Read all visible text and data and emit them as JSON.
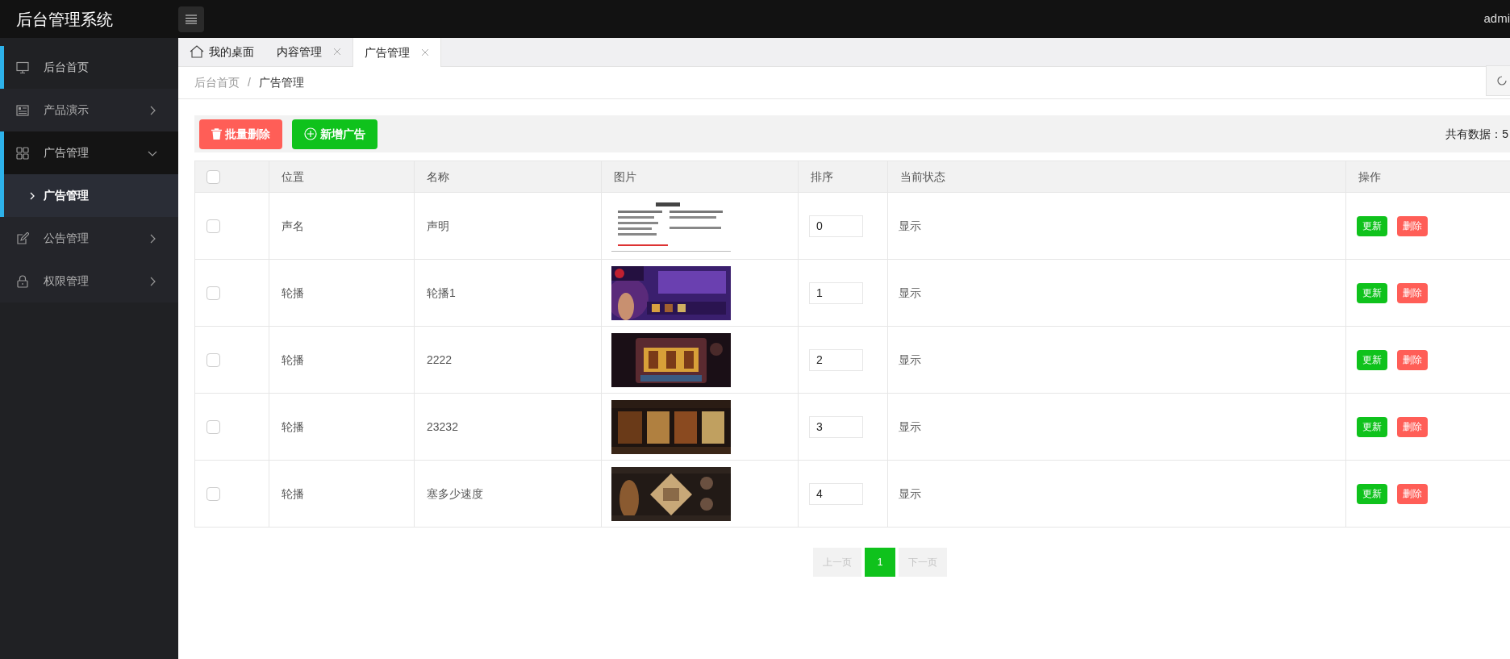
{
  "app_title": "后台管理系统",
  "user": "admi",
  "sidebar": {
    "items": [
      {
        "label": "后台首页",
        "kind": "link",
        "selected": true
      },
      {
        "label": "产品演示",
        "kind": "group",
        "selected": false,
        "expanded": false
      },
      {
        "label": "广告管理",
        "kind": "group",
        "selected": true,
        "expanded": true,
        "children": [
          {
            "label": "广告管理",
            "selected": true
          }
        ]
      },
      {
        "label": "公告管理",
        "kind": "group",
        "selected": false,
        "expanded": false
      },
      {
        "label": "权限管理",
        "kind": "group",
        "selected": false,
        "expanded": false
      }
    ]
  },
  "tabs": [
    {
      "label": "我的桌面",
      "closable": false,
      "selected": false
    },
    {
      "label": "内容管理",
      "closable": true,
      "selected": false
    },
    {
      "label": "广告管理",
      "closable": true,
      "selected": true
    }
  ],
  "breadcrumb": [
    "后台首页",
    "广告管理"
  ],
  "breadcrumb_separator": "/",
  "toolbar": {
    "batch_delete": "批量删除",
    "add": "新增广告",
    "total": "共有数据：5"
  },
  "table": {
    "header_checked": false,
    "columns": [
      "位置",
      "名称",
      "图片",
      "排序",
      "当前状态",
      "操作"
    ],
    "rows": [
      {
        "checked": false,
        "position": "声名",
        "name": "声明",
        "order": "0",
        "status": "显示",
        "actions": [
          "更新",
          "删除"
        ]
      },
      {
        "checked": false,
        "position": "轮播",
        "name": "轮播1",
        "order": "1",
        "status": "显示",
        "actions": [
          "更新",
          "删除"
        ]
      },
      {
        "checked": false,
        "position": "轮播",
        "name": "2222",
        "order": "2",
        "status": "显示",
        "actions": [
          "更新",
          "删除"
        ]
      },
      {
        "checked": false,
        "position": "轮播",
        "name": "23232",
        "order": "3",
        "status": "显示",
        "actions": [
          "更新",
          "删除"
        ]
      },
      {
        "checked": false,
        "position": "轮播",
        "name": "塞多少速度",
        "order": "4",
        "status": "显示",
        "actions": [
          "更新",
          "删除"
        ]
      }
    ]
  },
  "pagination": [
    {
      "label": "上一页",
      "kind": "prev",
      "disabled": true,
      "selected": false
    },
    {
      "label": "1",
      "kind": "page",
      "disabled": false,
      "selected": true
    },
    {
      "label": "下一页",
      "kind": "next",
      "disabled": true,
      "selected": false
    }
  ]
}
